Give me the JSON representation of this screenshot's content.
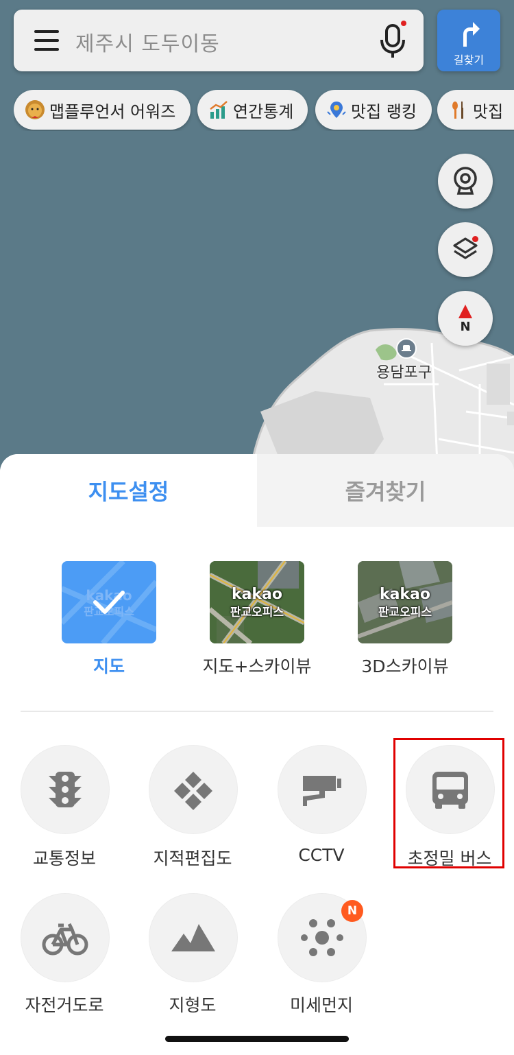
{
  "search": {
    "text": "제주시 도두이동"
  },
  "route_button": {
    "label": "길찾기"
  },
  "chips": [
    {
      "label": "맵플루언서 어워즈",
      "icon": "lion-face-icon"
    },
    {
      "label": "연간통계",
      "icon": "chart-icon"
    },
    {
      "label": "맛집 랭킹",
      "icon": "medal-pin-icon"
    },
    {
      "label": "맛집",
      "icon": "utensils-icon"
    }
  ],
  "map": {
    "place_label": "용담포구",
    "compass_label": "N"
  },
  "tabs": {
    "active": "지도설정",
    "inactive": "즐겨찾기"
  },
  "map_types": [
    {
      "label": "지도",
      "selected": true,
      "thumb_text_1": "kakao",
      "thumb_text_2": "판교오피스"
    },
    {
      "label": "지도+스카이뷰",
      "selected": false,
      "thumb_text_1": "kakao",
      "thumb_text_2": "판교오피스"
    },
    {
      "label": "3D스카이뷰",
      "selected": false,
      "thumb_text_1": "kakao",
      "thumb_text_2": "판교오피스"
    }
  ],
  "options": [
    {
      "label": "교통정보",
      "icon": "traffic-light-icon"
    },
    {
      "label": "지적편집도",
      "icon": "cadastral-tiles-icon"
    },
    {
      "label": "CCTV",
      "icon": "cctv-camera-icon"
    },
    {
      "label": "초정밀 버스",
      "icon": "bus-icon"
    },
    {
      "label": "자전거도로",
      "icon": "bicycle-icon"
    },
    {
      "label": "지형도",
      "icon": "mountain-icon"
    },
    {
      "label": "미세먼지",
      "icon": "fine-dust-icon",
      "badge": "N"
    }
  ],
  "colors": {
    "accent": "#3d8ff0",
    "route_button": "#3d82d8",
    "highlight": "#e00000",
    "badge": "#ff5a1f"
  }
}
